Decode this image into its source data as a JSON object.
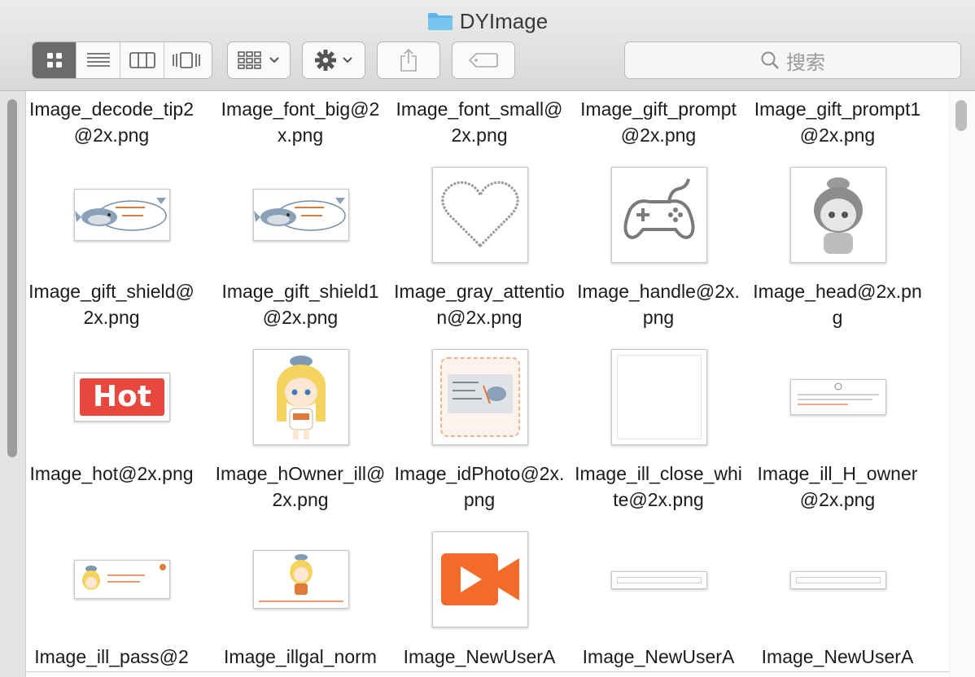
{
  "window": {
    "title": "DYImage"
  },
  "toolbar": {
    "view_modes": [
      "icon-view",
      "list-view",
      "column-view",
      "cover-flow-view"
    ],
    "active_view": "icon-view",
    "arrange_icon": "group-grid-icon",
    "action_icon": "gear-icon",
    "share_icon": "share-icon",
    "tag_icon": "tag-icon"
  },
  "search": {
    "placeholder": "搜索"
  },
  "files": {
    "row0": [
      "Image_decode_tip2@2x.png",
      "Image_font_big@2x.png",
      "Image_font_small@2x.png",
      "Image_gift_prompt@2x.png",
      "Image_gift_prompt1@2x.png"
    ],
    "row1": [
      "Image_gift_shield@2x.png",
      "Image_gift_shield1@2x.png",
      "Image_gray_attention@2x.png",
      "Image_handle@2x.png",
      "Image_head@2x.png"
    ],
    "row2": [
      "Image_hot@2x.png",
      "Image_hOwner_ill@2x.png",
      "Image_idPhoto@2x.png",
      "Image_ill_close_white@2x.png",
      "Image_ill_H_owner@2x.png"
    ],
    "row3": [
      "Image_ill_pass@2",
      "Image_illgal_norm",
      "Image_NewUserA",
      "Image_NewUserA",
      "Image_NewUserA"
    ]
  },
  "thumb_text": {
    "hot": "Hot"
  },
  "colors": {
    "hot_red": "#e8473d",
    "video_orange": "#f26b2a",
    "active_segment": "#6b6b6b",
    "folder_blue": "#5fb4e8"
  }
}
